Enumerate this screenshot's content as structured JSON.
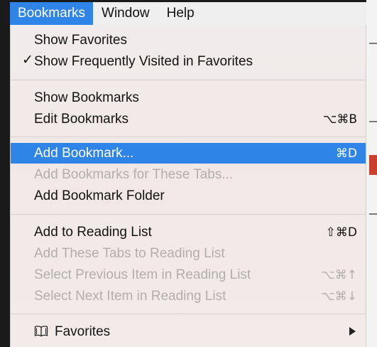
{
  "menubar": {
    "items": [
      {
        "label": "Bookmarks"
      },
      {
        "label": "Window"
      },
      {
        "label": "Help"
      }
    ]
  },
  "menu": {
    "show_favorites": "Show Favorites",
    "show_freq_check": "✓",
    "show_freq": "Show Frequently Visited in Favorites",
    "show_bookmarks": "Show Bookmarks",
    "edit_bookmarks": "Edit Bookmarks",
    "edit_bookmarks_shortcut": "⌥⌘B",
    "add_bookmark": "Add Bookmark...",
    "add_bookmark_shortcut": "⌘D",
    "add_bookmarks_tabs": "Add Bookmarks for These Tabs...",
    "add_bookmark_folder": "Add Bookmark Folder",
    "add_reading_list": "Add to Reading List",
    "add_reading_list_shortcut": "⇧⌘D",
    "add_tabs_reading": "Add These Tabs to Reading List",
    "select_prev": "Select Previous Item in Reading List",
    "select_prev_shortcut": "⌥⌘↑",
    "select_next": "Select Next Item in Reading List",
    "select_next_shortcut": "⌥⌘↓",
    "favorites": "Favorites"
  },
  "colors": {
    "highlight": "#2f85e7",
    "disabled_text": "#b2aeae"
  }
}
